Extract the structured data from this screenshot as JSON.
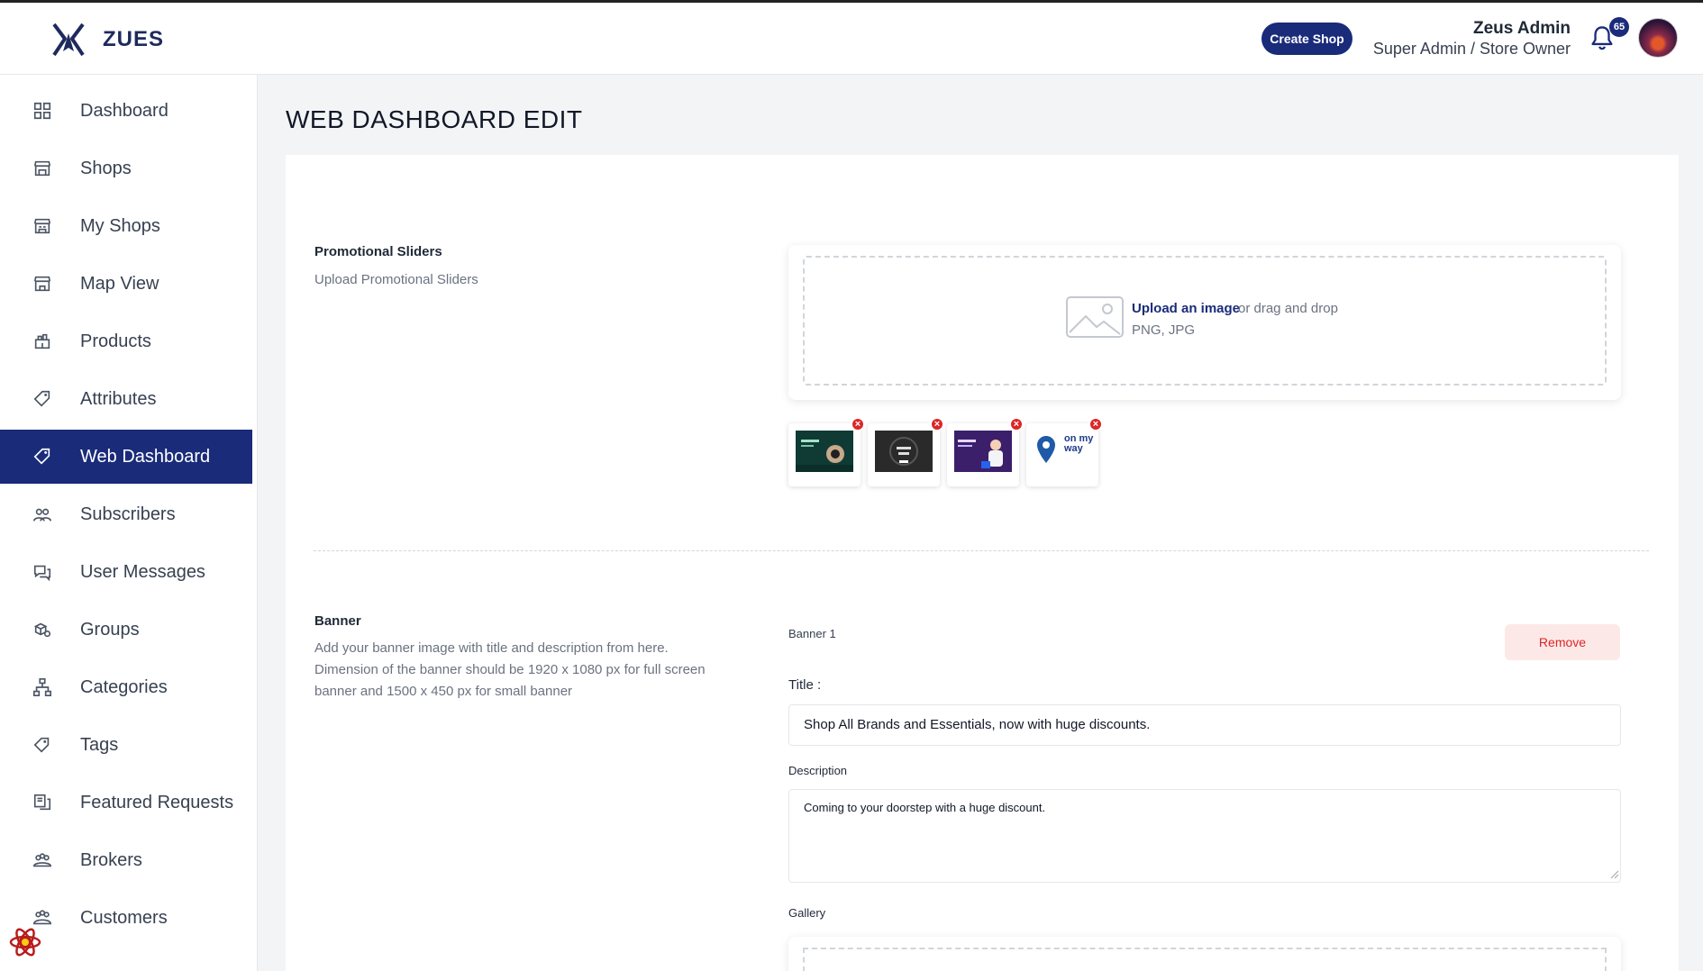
{
  "app": {
    "brand": "ZUES"
  },
  "header": {
    "create_shop_label": "Create Shop",
    "user_name": "Zeus Admin",
    "user_role": "Super Admin / Store Owner",
    "notification_count": "65"
  },
  "sidebar": {
    "items": [
      {
        "label": "Dashboard",
        "icon": "grid-icon"
      },
      {
        "label": "Shops",
        "icon": "store-icon"
      },
      {
        "label": "My Shops",
        "icon": "my-store-icon"
      },
      {
        "label": "Map View",
        "icon": "map-store-icon"
      },
      {
        "label": "Products",
        "icon": "products-icon"
      },
      {
        "label": "Attributes",
        "icon": "tag-icon"
      },
      {
        "label": "Web Dashboard",
        "icon": "tag-icon",
        "active": true
      },
      {
        "label": "Subscribers",
        "icon": "users-icon"
      },
      {
        "label": "User Messages",
        "icon": "messages-icon"
      },
      {
        "label": "Groups",
        "icon": "groups-icon"
      },
      {
        "label": "Categories",
        "icon": "hierarchy-icon"
      },
      {
        "label": "Tags",
        "icon": "label-icon"
      },
      {
        "label": "Featured Requests",
        "icon": "requests-icon"
      },
      {
        "label": "Brokers",
        "icon": "brokers-icon"
      },
      {
        "label": "Customers",
        "icon": "customers-icon"
      }
    ]
  },
  "page": {
    "title": "WEB DASHBOARD EDIT"
  },
  "promo": {
    "title": "Promotional Sliders",
    "description": "Upload Promotional Sliders",
    "upload_link": "Upload an image",
    "upload_rest": "or drag and drop",
    "upload_types": "PNG, JPG",
    "thumbnails": [
      {
        "name": "slider-thumb-1",
        "color": "#0f3b34"
      },
      {
        "name": "slider-thumb-2",
        "color": "#2a2a2a"
      },
      {
        "name": "slider-thumb-3",
        "color": "#3b1f6b"
      },
      {
        "name": "slider-thumb-4",
        "color": "#ffffff"
      }
    ],
    "logo_text": "on my way"
  },
  "banner": {
    "title": "Banner",
    "description": "Add your banner image with title and description from here. Dimension of the banner should be 1920 x 1080 px for full screen banner and 1500 x 450 px for small banner",
    "item_label": "Banner 1",
    "remove_label": "Remove",
    "title_label": "Title :",
    "title_value": "Shop All Brands and Essentials, now with huge discounts.",
    "description_label": "Description",
    "description_value": "Coming to your doorstep with a huge discount.",
    "gallery_label": "Gallery"
  }
}
